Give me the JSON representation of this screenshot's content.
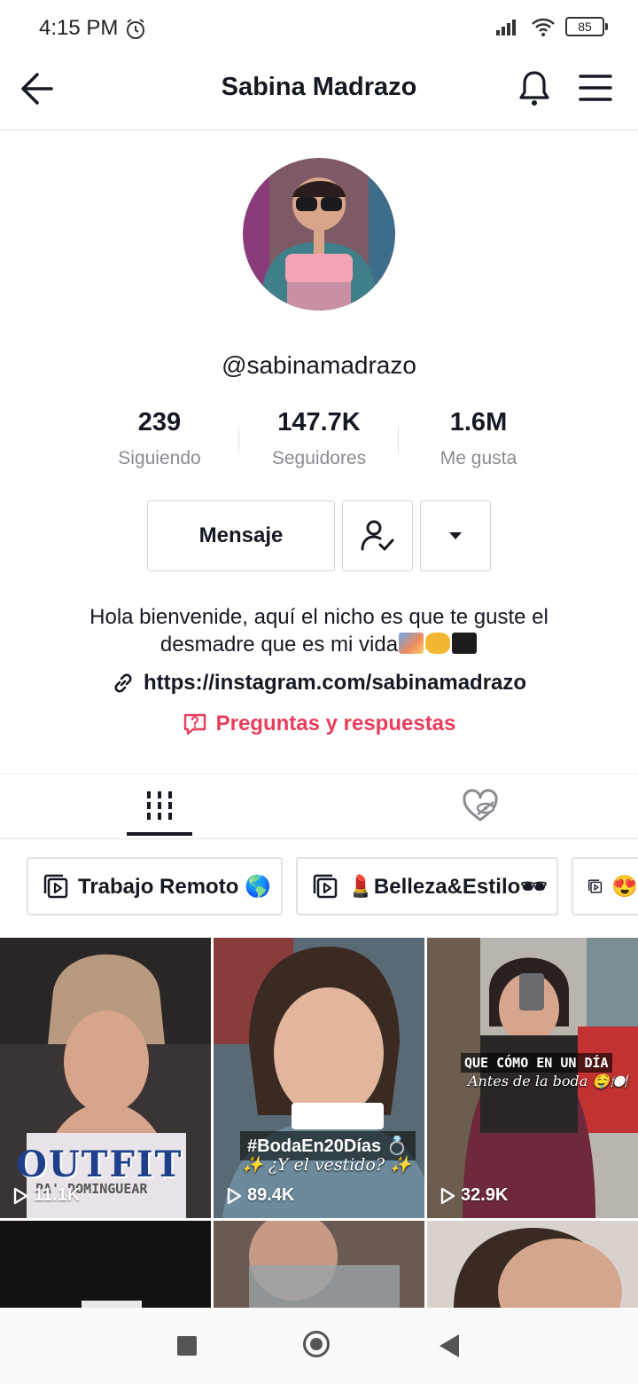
{
  "status": {
    "time": "4:15 PM",
    "battery": "85"
  },
  "header": {
    "title": "Sabina Madrazo"
  },
  "profile": {
    "username": "@sabinamadrazo",
    "stats": [
      {
        "value": "239",
        "label": "Siguiendo"
      },
      {
        "value": "147.7K",
        "label": "Seguidores"
      },
      {
        "value": "1.6M",
        "label": "Me gusta"
      }
    ],
    "message_button": "Mensaje",
    "bio_line1": "Hola bienvenide, aquí el nicho es que te guste el",
    "bio_line2": "desmadre que es mi vida",
    "link": "https://instagram.com/sabinamadrazo",
    "qa_label": "Preguntas y respuestas"
  },
  "playlists": [
    {
      "label": "Trabajo Remoto 🌎"
    },
    {
      "label": "💄Belleza&Estilo🕶"
    },
    {
      "label": "😍"
    }
  ],
  "videos": [
    {
      "views": "11.1K",
      "overlay_main": "OUTFIT",
      "overlay_sub": "PA' DOMINGUEAR"
    },
    {
      "views": "89.4K",
      "overlay_main": "#BodaEn20Días 💍",
      "overlay_sub": "✨ ¿Y el vestido? ✨"
    },
    {
      "views": "32.9K",
      "overlay_main": "QUE CÓMO EN UN DÍA",
      "overlay_sub": "Antes de la boda 🤤🍽️"
    }
  ],
  "colors": {
    "accent": "#e83e5d",
    "text": "#161823",
    "muted": "#8a8b91"
  }
}
